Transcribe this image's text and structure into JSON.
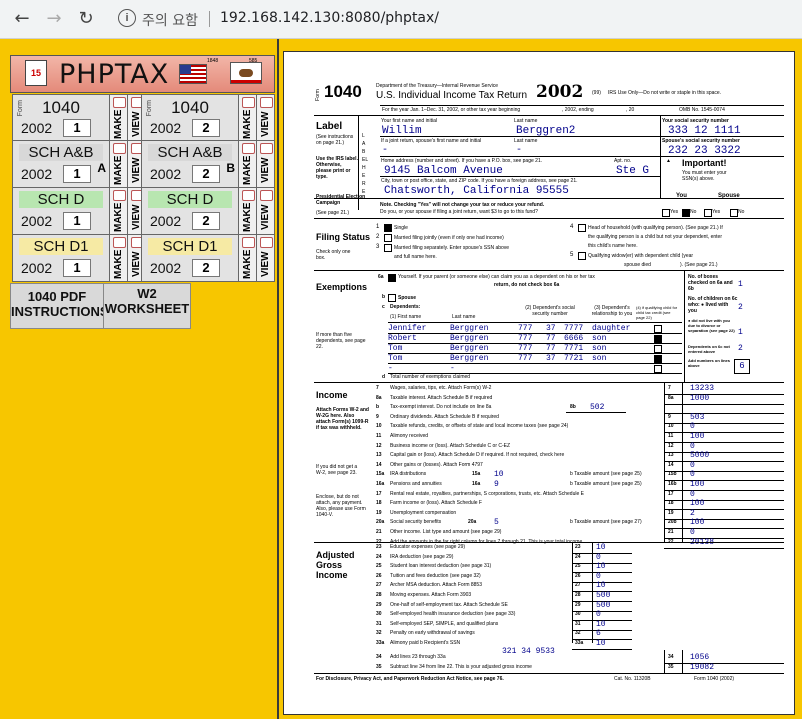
{
  "browser": {
    "back_icon": "arrow-left-icon",
    "forward_icon": "arrow-right-icon",
    "reload_icon": "reload-icon",
    "security_label": "주의 요함",
    "url": "192.168.142.130:8080/phptax/"
  },
  "sidebar": {
    "logo_title": "PHPTAX",
    "logo_calendar": "15",
    "logo_flag_year": "1848",
    "logo_bear_year": "585",
    "tiles": [
      {
        "name": "1040",
        "small": "Form",
        "year": "2002",
        "num": "1",
        "make": "MAKE",
        "view": "VIEW"
      },
      {
        "name": "1040",
        "small": "Form",
        "year": "2002",
        "num": "2",
        "make": "MAKE",
        "view": "VIEW"
      },
      {
        "name": "SCH A&B",
        "letter": "A",
        "year": "2002",
        "num": "1",
        "make": "MAKE",
        "view": "VIEW"
      },
      {
        "name": "SCH A&B",
        "letter": "B",
        "year": "2002",
        "num": "2",
        "make": "MAKE",
        "view": "VIEW"
      },
      {
        "name": "SCH D",
        "year": "2002",
        "num": "1",
        "make": "MAKE",
        "view": "VIEW"
      },
      {
        "name": "SCH D",
        "year": "2002",
        "num": "2",
        "make": "MAKE",
        "view": "VIEW"
      },
      {
        "name": "SCH D1",
        "year": "2002",
        "num": "1",
        "make": "MAKE",
        "view": "VIEW"
      },
      {
        "name": "SCH D1",
        "year": "2002",
        "num": "2",
        "make": "MAKE",
        "view": "VIEW"
      }
    ],
    "pdf_link": [
      "1040 PDF",
      "INSTRUCTIONS"
    ],
    "w2_link": [
      "W2",
      "WORKSHEET"
    ]
  },
  "form": {
    "form_label": "Form",
    "form_number": "1040",
    "dept": "Department of the Treasury—Internal Revenue Service",
    "title": "U.S. Individual Income Tax Return",
    "year": "2002",
    "code": "(99)",
    "irs_use": "IRS Use Only—Do not write or staple in this space.",
    "tax_year_line": "For the year Jan. 1–Dec. 31, 2002, or other tax year beginning",
    "ending": ", 2002, ending",
    "comma20": ", 20",
    "omb": "OMB No. 1545-0074",
    "label_heading": "Label",
    "label_see": "(See instructions on page 21.)",
    "label_use": "Use the IRS label. Otherwise, please print or type.",
    "label_vertical": "LABEL HERE",
    "presidential": "Presidential Election Campaign",
    "presidential_see": "(See page 21.)",
    "first_name_label": "Your first name and initial",
    "last_name_label": "Last name",
    "first_name": "Willim",
    "last_name": "Berggren2",
    "ssn_label": "Your social security number",
    "ssn": "333 12 1111",
    "spouse_first_label": "If a joint return, spouse's first name and initial",
    "spouse_last_label": "Last name",
    "spouse_first": "-",
    "spouse_last": "-",
    "spouse_ssn_label": "Spouse's social security number",
    "spouse_ssn": "232 23 3322",
    "address_label": "Home address (number and street). If you have a P.O. box, see page 21.",
    "apt_label": "Apt. no.",
    "address": "9145 Balcom Avenue",
    "apt": "Ste G",
    "city_label": "City, town or post office, state, and ZIP code. If you have a foreign address, see page 21.",
    "city": "Chatsworth, California 95555",
    "important": "Important!",
    "important_text": "You must enter your SSN(s) above.",
    "pec_note": "Note. Checking \"Yes\" will not change your tax or reduce your refund.",
    "pec_question": "Do you, or your spouse if filing a joint return, want $3 to go to this fund?",
    "you": "You",
    "spouse": "Spouse",
    "yes": "Yes",
    "no": "No",
    "filing_status": "Filing Status",
    "filing_check": "Check only one box.",
    "fs1": "Single",
    "fs2": "Married filing jointly (even if only one had income)",
    "fs3": "Married filing separately. Enter spouse's SSN above",
    "fs3b": "and full name here.",
    "fs4": "Head of household (with qualifying person). (See page 21.) If",
    "fs4b": "the qualifying person is a child but not your dependent, enter",
    "fs4c": "this child's name here.",
    "fs5": "Qualifying widow(er) with dependent child (year",
    "fs5b": "spouse died",
    "fs5c": "). (See page 21.)",
    "exemptions": "Exemptions",
    "ex6a": "Yourself. If your parent (or someone else) can claim you as a dependent on his or her tax",
    "ex6a2": "return, do not check box 6a",
    "ex6b": "Spouse",
    "ex6c": "Dependents:",
    "dep_first": "(1) First name",
    "dep_last": "Last name",
    "dep_ssn": "(2) Dependent's social security number",
    "dep_rel": "(3) Dependent's relationship to you",
    "dep_credit": "(4) if qualifying child for child tax credit (see page 22)",
    "dep_more": "If more than five dependents, see page 22.",
    "dependents": [
      {
        "first": "Jennifer",
        "last": "Berggren",
        "s1": "777",
        "s2": "37",
        "s3": "7777",
        "rel": "daughter",
        "child": false
      },
      {
        "first": "Robert",
        "last": "Berggren",
        "s1": "777",
        "s2": "77",
        "s3": "6666",
        "rel": "son",
        "child": true
      },
      {
        "first": "Tom",
        "last": "Berggren",
        "s1": "777",
        "s2": "77",
        "s3": "7771",
        "rel": "son",
        "child": false
      },
      {
        "first": "Tom",
        "last": "Berggren",
        "s1": "777",
        "s2": "37",
        "s3": "7721",
        "rel": "son",
        "child": true
      },
      {
        "first": "-",
        "last": "-",
        "s1": "",
        "s2": "",
        "s3": "",
        "rel": "",
        "child": false
      }
    ],
    "ex6d": "Total number of exemptions claimed",
    "boxes_checked": "No. of boxes checked on 6a and 6b",
    "boxes_checked_val": "1",
    "children_lived": "No. of children on 6c who: ● lived with you",
    "children_lived_val": "2",
    "children_not": "● did not live with you due to divorce or separation (see page 22)",
    "children_not_val": "1",
    "dep_not_entered": "Dependents on 6c not entered above",
    "dep_not_entered_val": "2",
    "add_numbers": "Add numbers on lines above",
    "add_numbers_val": "6",
    "income": "Income",
    "income_attach": "Attach Forms W-2 and W-2G here. Also attach Form(s) 1099-R if tax was withheld.",
    "income_no_w2": "If you did not get a W-2, see page 23.",
    "income_enclose": "Enclose, but do not attach, any payment. Also, please use Form 1040-V.",
    "income_lines": [
      {
        "n": "7",
        "t": "Wages, salaries, tips, etc. Attach Form(s) W-2",
        "r": "7",
        "v": "13233"
      },
      {
        "n": "8a",
        "t": "Taxable interest. Attach Schedule B if required",
        "r": "8a",
        "v": "1000"
      },
      {
        "n": "b",
        "t": "Tax-exempt interest. Do not include on line 8a",
        "r": "",
        "v": ""
      },
      {
        "n": "9",
        "t": "Ordinary dividends. Attach Schedule B if required",
        "r": "9",
        "v": "503"
      },
      {
        "n": "10",
        "t": "Taxable refunds, credits, or offsets of state and local income taxes (see page 24)",
        "r": "10",
        "v": "0"
      },
      {
        "n": "11",
        "t": "Alimony received",
        "r": "11",
        "v": "100"
      },
      {
        "n": "12",
        "t": "Business income or (loss). Attach Schedule C or C-EZ",
        "r": "12",
        "v": "0"
      },
      {
        "n": "13",
        "t": "Capital gain or (loss). Attach Schedule D if required. If not required, check here",
        "r": "13",
        "v": "5000"
      },
      {
        "n": "14",
        "t": "Other gains or (losses). Attach Form 4797",
        "r": "14",
        "v": "0"
      },
      {
        "n": "15a",
        "t": "IRA distributions",
        "r": "15b",
        "v": "0"
      },
      {
        "n": "16a",
        "t": "Pensions and annuities",
        "r": "16b",
        "v": "100"
      },
      {
        "n": "17",
        "t": "Rental real estate, royalties, partnerships, S corporations, trusts, etc. Attach Schedule E",
        "r": "17",
        "v": "0"
      },
      {
        "n": "18",
        "t": "Farm income or (loss). Attach Schedule F",
        "r": "18",
        "v": "100"
      },
      {
        "n": "19",
        "t": "Unemployment compensation",
        "r": "19",
        "v": "2"
      },
      {
        "n": "20a",
        "t": "Social security benefits",
        "r": "20b",
        "v": "100"
      },
      {
        "n": "21",
        "t": "Other income. List type and amount (see page 29)",
        "r": "21",
        "v": "0"
      },
      {
        "n": "22",
        "t": "Add the amounts in the far right column for lines 7 through 21. This is your total income",
        "r": "22",
        "v": "20138"
      }
    ],
    "l8b_label": "8b",
    "l8b_val": "502",
    "l15a_label": "15a",
    "l15a_val": "10",
    "l15b_text": "b Taxable amount (see page 25)",
    "l16a_label": "16a",
    "l16a_val": "9",
    "l16b_text": "b Taxable amount (see page 25)",
    "l20a_label": "20a",
    "l20a_val": "5",
    "l20b_text": "b Taxable amount (see page 27)",
    "agi": "Adjusted Gross Income",
    "agi_lines": [
      {
        "n": "23",
        "t": "Educator expenses (see page 29)",
        "v": "10"
      },
      {
        "n": "24",
        "t": "IRA deduction (see page 29)",
        "v": "0"
      },
      {
        "n": "25",
        "t": "Student loan interest deduction (see page 31)",
        "v": "10"
      },
      {
        "n": "26",
        "t": "Tuition and fees deduction (see page 32)",
        "v": "0"
      },
      {
        "n": "27",
        "t": "Archer MSA deduction. Attach Form 8853",
        "v": "10"
      },
      {
        "n": "28",
        "t": "Moving expenses. Attach Form 3903",
        "v": "500"
      },
      {
        "n": "29",
        "t": "One-half of self-employment tax. Attach Schedule SE",
        "v": "500"
      },
      {
        "n": "30",
        "t": "Self-employed health insurance deduction (see page 33)",
        "v": "0"
      },
      {
        "n": "31",
        "t": "Self-employed SEP, SIMPLE, and qualified plans",
        "v": "10"
      },
      {
        "n": "32",
        "t": "Penalty on early withdrawal of savings",
        "v": "6"
      },
      {
        "n": "33a",
        "t": "Alimony paid   b Recipient's SSN",
        "v": "10"
      }
    ],
    "recipient_ssn": "321 34 9533",
    "l34_text": "Add lines 23 through 33a",
    "l34_val": "1056",
    "l35_text": "Subtract line 34 from line 22. This is your adjusted gross income",
    "l35_val": "19082",
    "footer_left": "For Disclosure, Privacy Act, and Paperwork Reduction Act Notice, see page 76.",
    "footer_cat": "Cat. No. 11320B",
    "footer_right": "Form 1040 (2002)"
  }
}
